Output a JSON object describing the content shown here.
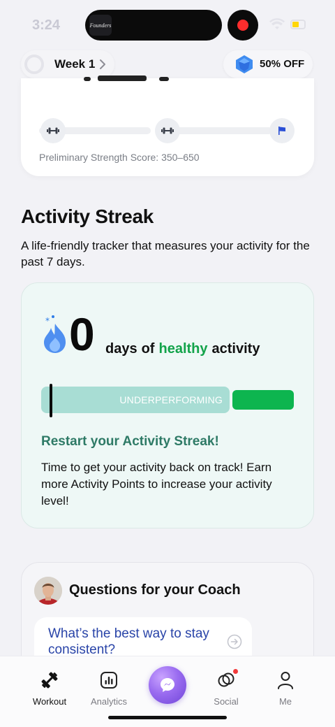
{
  "status_bar": {
    "time": "3:24",
    "island_thumb_text": "Founders"
  },
  "top_bar": {
    "week_label": "Week 1",
    "discount_label": "50% OFF"
  },
  "strength_card": {
    "score_text": "Preliminary Strength Score: 350–650"
  },
  "activity_streak": {
    "title": "Activity Streak",
    "description": "A life-friendly tracker that measures your activity for the past 7 days.",
    "count": "0",
    "days_word": "days",
    "of_word": "of",
    "healthy_word": "healthy",
    "activity_word": "activity",
    "bar_label": "UNDERPERFORMING",
    "restart_title": "Restart your Activity Streak!",
    "restart_text": "Time to get your activity back on track! Earn more Activity Points to increase your activity level!"
  },
  "coach": {
    "title": "Questions for your Coach",
    "question": "What’s the best way to stay consistent?"
  },
  "tab_bar": {
    "tabs": [
      {
        "label": "Workout",
        "icon": "dumbbell-icon",
        "active": true
      },
      {
        "label": "Analytics",
        "icon": "analytics-icon",
        "active": false
      },
      {
        "label": "",
        "icon": "lightning-bubble-icon",
        "active": false
      },
      {
        "label": "Social",
        "icon": "social-rings-icon",
        "active": false
      },
      {
        "label": "Me",
        "icon": "person-icon",
        "active": false
      }
    ]
  },
  "colors": {
    "healthy_green": "#12a34a",
    "restart_green": "#2e7a66",
    "question_blue": "#2944a8",
    "accent_purple": "#9a6cf0"
  }
}
